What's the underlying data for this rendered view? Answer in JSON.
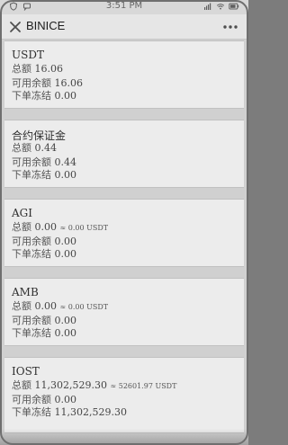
{
  "status": {
    "time": "3:51 PM"
  },
  "header": {
    "title": "BINICE"
  },
  "cards": [
    {
      "title": "USDT",
      "total_label": "总额",
      "total_value": "16.06",
      "total_suffix": "",
      "available_label": "可用余额",
      "available_value": "16.06",
      "frozen_label": "下单冻结",
      "frozen_value": "0.00"
    },
    {
      "title": "合约保证金",
      "total_label": "总额",
      "total_value": "0.44",
      "total_suffix": "",
      "available_label": "可用余额",
      "available_value": "0.44",
      "frozen_label": "下单冻结",
      "frozen_value": "0.00"
    },
    {
      "title": "AGI",
      "total_label": "总额",
      "total_value": "0.00",
      "total_suffix": "≈ 0.00 USDT",
      "available_label": "可用余额",
      "available_value": "0.00",
      "frozen_label": "下单冻结",
      "frozen_value": "0.00"
    },
    {
      "title": "AMB",
      "total_label": "总额",
      "total_value": "0.00",
      "total_suffix": "≈ 0.00 USDT",
      "available_label": "可用余额",
      "available_value": "0.00",
      "frozen_label": "下单冻结",
      "frozen_value": "0.00"
    },
    {
      "title": "IOST",
      "total_label": "总额",
      "total_value": "11,302,529.30",
      "total_suffix": "≈ 52601.97 USDT",
      "available_label": "可用余额",
      "available_value": "0.00",
      "frozen_label": "下单冻结",
      "frozen_value": "11,302,529.30"
    }
  ],
  "icons": {
    "close": "close-icon",
    "more": "more-icon",
    "battery": "battery-icon",
    "wifi": "wifi-icon",
    "signal": "signal-icon",
    "shield": "shield-icon",
    "message": "message-icon"
  }
}
